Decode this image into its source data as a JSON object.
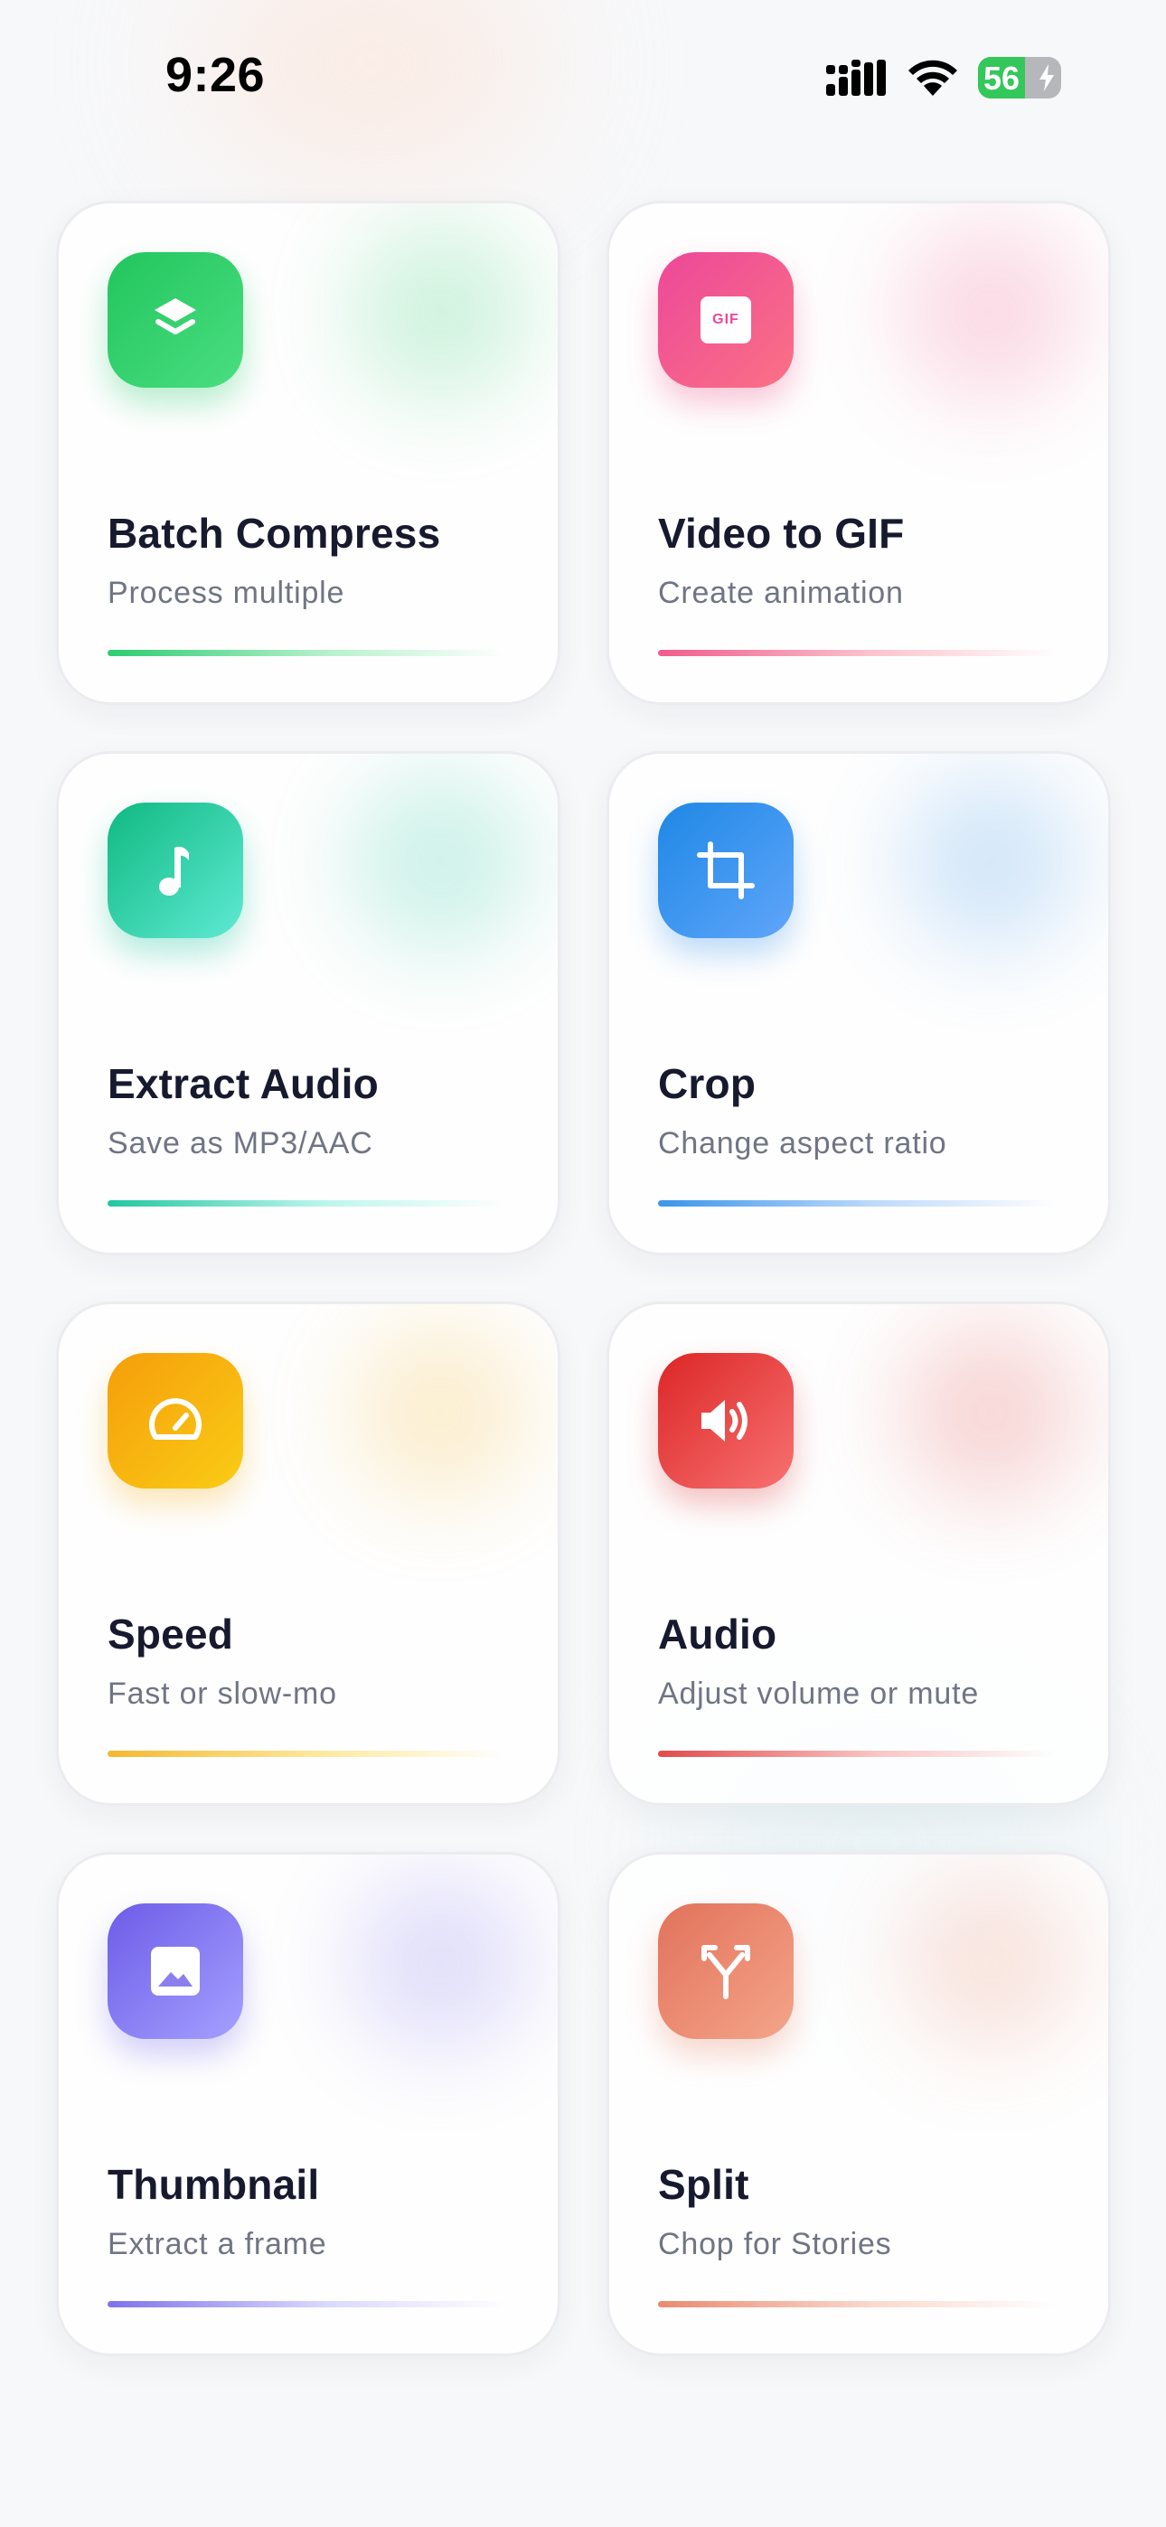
{
  "status_bar": {
    "time": "9:26",
    "battery_level": "56",
    "battery_fill_percent": 56
  },
  "tools": [
    {
      "title": "Batch Compress",
      "subtitle": "Process multiple",
      "icon": "layers-icon",
      "gradient": [
        "#22c55e",
        "#4ade80"
      ],
      "accent": "#2ecc71"
    },
    {
      "title": "Video to GIF",
      "subtitle": "Create animation",
      "icon": "gif-icon",
      "icon_text": "GIF",
      "gradient": [
        "#ec4899",
        "#fb7185"
      ],
      "accent": "#f05b8c"
    },
    {
      "title": "Extract Audio",
      "subtitle": "Save as MP3/AAC",
      "icon": "music-note-icon",
      "gradient": [
        "#10b981",
        "#5eead4"
      ],
      "accent": "#22c6a0"
    },
    {
      "title": "Crop",
      "subtitle": "Change aspect ratio",
      "icon": "crop-icon",
      "gradient": [
        "#1e88e5",
        "#60a5fa"
      ],
      "accent": "#3b95e9"
    },
    {
      "title": "Speed",
      "subtitle": "Fast or slow-mo",
      "icon": "speedometer-icon",
      "gradient": [
        "#f59e0b",
        "#facc15"
      ],
      "accent": "#f5b82e"
    },
    {
      "title": "Audio",
      "subtitle": "Adjust volume or mute",
      "icon": "speaker-icon",
      "gradient": [
        "#dc2626",
        "#f87171"
      ],
      "accent": "#e24a4a"
    },
    {
      "title": "Thumbnail",
      "subtitle": "Extract a frame",
      "icon": "image-icon",
      "gradient": [
        "#6d5ce8",
        "#a5a0ff"
      ],
      "accent": "#7f72ec"
    },
    {
      "title": "Split",
      "subtitle": "Chop for Stories",
      "icon": "split-icon",
      "gradient": [
        "#e2725b",
        "#f4a58a"
      ],
      "accent": "#ea8a70"
    }
  ]
}
